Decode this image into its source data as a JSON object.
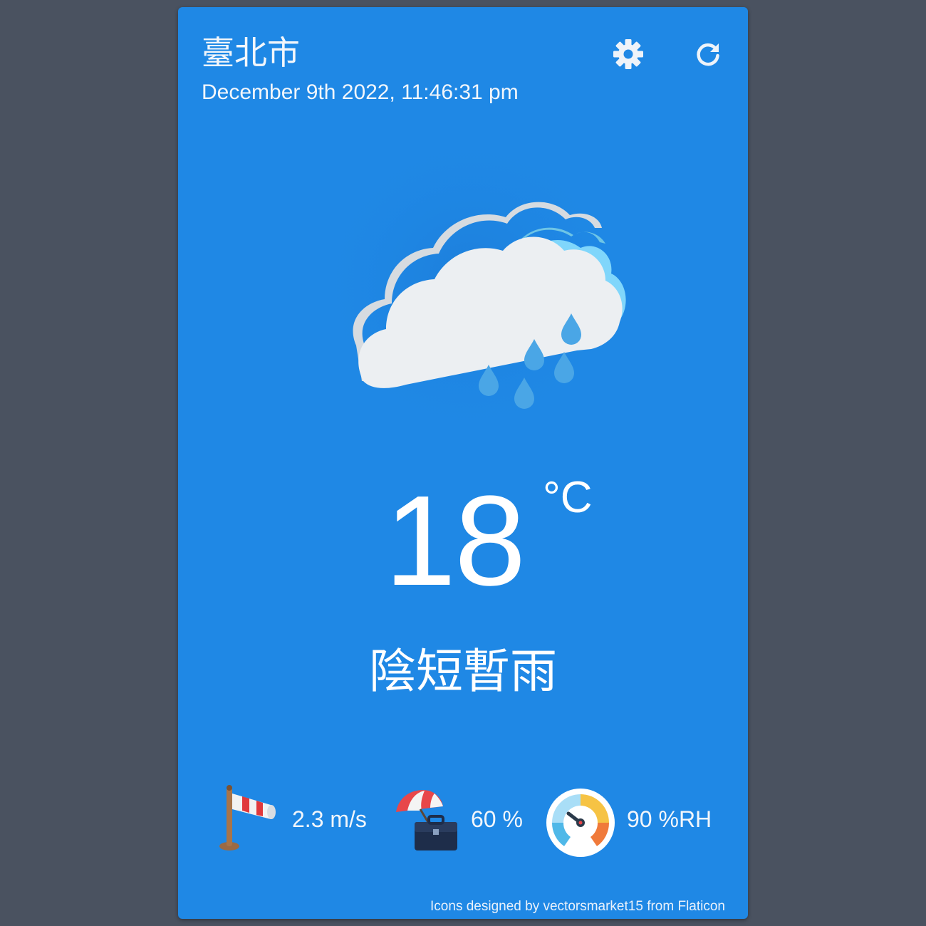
{
  "header": {
    "city": "臺北市",
    "datetime": "December 9th 2022, 11:46:31 pm"
  },
  "icons": {
    "settings": "gear-icon",
    "refresh": "refresh-icon",
    "weather": "cloud-rain-icon",
    "wind": "windsock-icon",
    "rain": "umbrella-briefcase-icon",
    "humidity": "gauge-icon"
  },
  "current": {
    "temperature": "18",
    "unit": "°C",
    "description": "陰短暫雨"
  },
  "stats": {
    "wind_speed": "2.3 m/s",
    "rain_probability": "60 %",
    "humidity": "90 %RH"
  },
  "footer": {
    "credit": "Icons designed by vectorsmarket15 from Flaticon"
  },
  "colors": {
    "card_background": "#1f88e5",
    "page_background": "#4a5260",
    "text": "#ffffff"
  }
}
